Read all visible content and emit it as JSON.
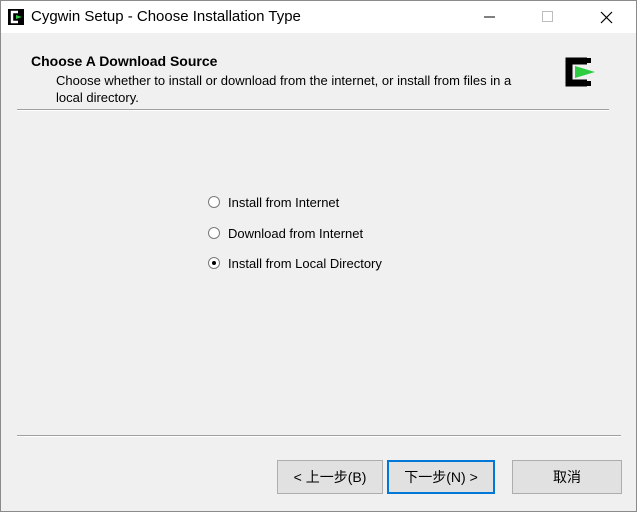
{
  "window": {
    "title": "Cygwin Setup - Choose Installation Type"
  },
  "header": {
    "title": "Choose A Download Source",
    "description": "Choose whether to install or download from the internet, or install from files in a local directory."
  },
  "options": [
    {
      "label": "Install from Internet",
      "selected": false
    },
    {
      "label": "Download from Internet",
      "selected": false
    },
    {
      "label": "Install from Local Directory",
      "selected": true
    }
  ],
  "buttons": {
    "back": "< 上一步(B)",
    "next": "下一步(N) >",
    "cancel": "取消"
  },
  "colors": {
    "logo_green": "#2ecc40",
    "focus_border": "#0078d7"
  }
}
